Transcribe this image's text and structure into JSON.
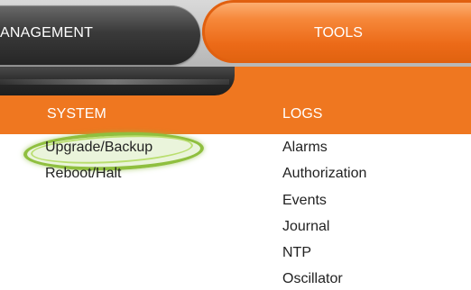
{
  "nav": {
    "management_label": "ANAGEMENT",
    "tools_label": "TOOLS"
  },
  "columns": {
    "system": {
      "heading": "SYSTEM",
      "items": [
        "Upgrade/Backup",
        "Reboot/Halt"
      ]
    },
    "logs": {
      "heading": "LOGS",
      "items": [
        "Alarms",
        "Authorization",
        "Events",
        "Journal",
        "NTP",
        "Oscillator"
      ]
    }
  },
  "colors": {
    "accent": "#ef7720",
    "highlight": "#8fbf3f",
    "tab_dark": "#262626"
  }
}
